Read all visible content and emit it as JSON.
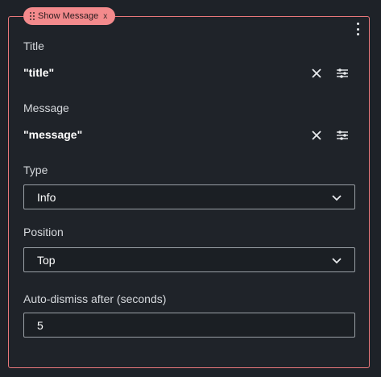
{
  "block": {
    "chip_label": "Show Message",
    "chip_close": "x"
  },
  "fields": {
    "title": {
      "label": "Title",
      "value": "\"title\""
    },
    "message": {
      "label": "Message",
      "value": "\"message\""
    },
    "type": {
      "label": "Type",
      "selected": "Info"
    },
    "position": {
      "label": "Position",
      "selected": "Top"
    },
    "auto_dismiss": {
      "label": "Auto-dismiss after (seconds)",
      "value": "5"
    }
  },
  "icons": {
    "kebab": "more-vertical-icon",
    "clear": "close-icon",
    "options": "sliders-icon",
    "chevron": "chevron-down-icon"
  },
  "colors": {
    "background": "#1e2228",
    "accent": "#f38a8c",
    "border": "#e8777a"
  }
}
